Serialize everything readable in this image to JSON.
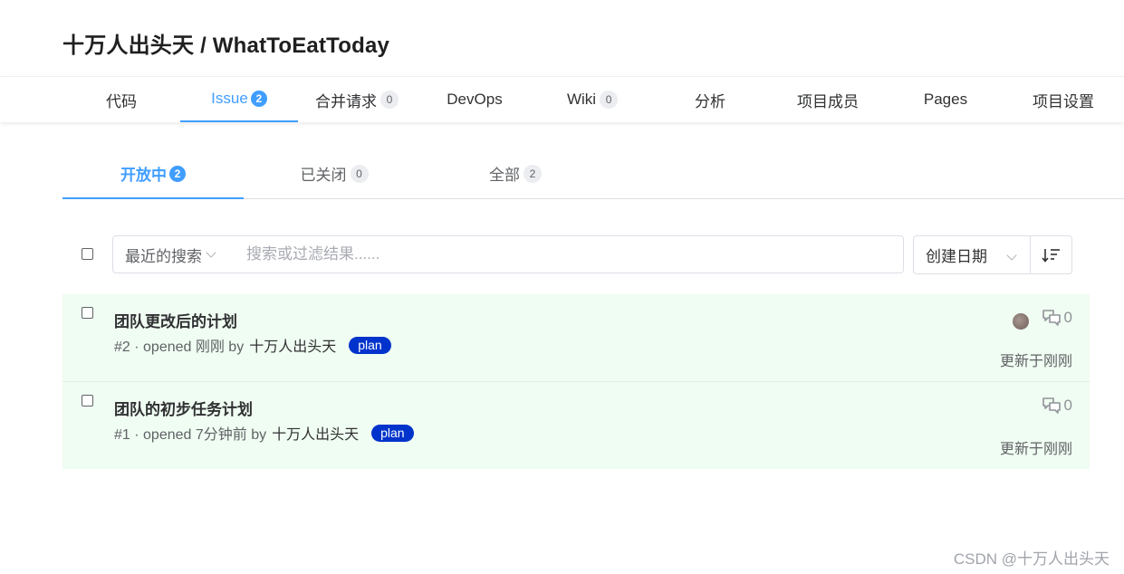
{
  "repo": {
    "title": "十万人出头天 / WhatToEatToday"
  },
  "nav": [
    {
      "label": "代码",
      "badge": ""
    },
    {
      "label": "Issue",
      "badge": "2"
    },
    {
      "label": "合并请求",
      "badge": "0"
    },
    {
      "label": "DevOps",
      "badge": ""
    },
    {
      "label": "Wiki",
      "badge": "0"
    },
    {
      "label": "分析",
      "badge": ""
    },
    {
      "label": "项目成员",
      "badge": ""
    },
    {
      "label": "Pages",
      "badge": ""
    },
    {
      "label": "项目设置",
      "badge": ""
    }
  ],
  "state_tabs": [
    {
      "label": "开放中",
      "count": "2"
    },
    {
      "label": "已关闭",
      "count": "0"
    },
    {
      "label": "全部",
      "count": "2"
    }
  ],
  "filters": {
    "recent_label": "最近的搜索",
    "search_placeholder": "搜索或过滤结果......",
    "sort_label": "创建日期"
  },
  "issues": [
    {
      "title": "团队更改后的计划",
      "meta": "#2 · opened 刚刚 by",
      "author": "十万人出头天",
      "label": "plan",
      "comments": "0",
      "updated": "更新于刚刚"
    },
    {
      "title": "团队的初步任务计划",
      "meta": "#1 · opened 7分钟前 by",
      "author": "十万人出头天",
      "label": "plan",
      "comments": "0",
      "updated": "更新于刚刚"
    }
  ],
  "colors": {
    "accent": "#409eff",
    "label_bg": "#0033cc",
    "issue_bg": "#f0fdf2"
  },
  "watermark": "CSDN @十万人出头天"
}
